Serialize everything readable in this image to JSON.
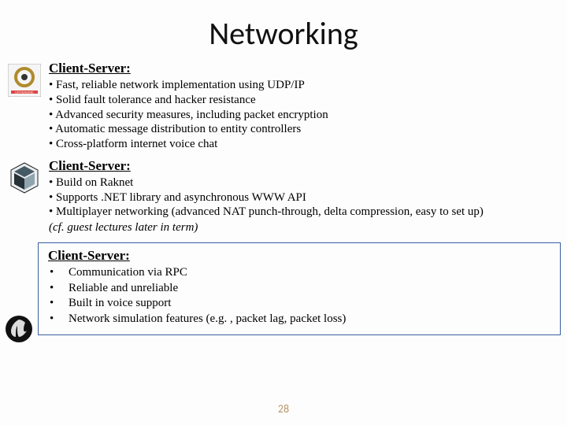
{
  "title": "Networking",
  "sections": [
    {
      "heading": "Client-Server:",
      "bullets": [
        "• Fast, reliable network implementation using UDP/IP",
        "• Solid fault tolerance and hacker resistance",
        "• Advanced security measures, including packet encryption",
        "• Automatic message distribution to entity controllers",
        "• Cross-platform internet voice chat"
      ]
    },
    {
      "heading": "Client-Server:",
      "bullets": [
        "• Build on Raknet",
        "• Supports .NET library and asynchronous WWW API",
        "• Multiplayer networking (advanced NAT punch-through, delta compression, easy to set up)"
      ],
      "note": "(cf. guest lectures later in term)"
    },
    {
      "heading": "Client-Server:",
      "bullets": [
        "Communication via RPC",
        "Reliable and unreliable",
        "Built in voice support",
        "Network simulation features (e.g. , packet lag, packet loss)"
      ]
    }
  ],
  "page_number": "28"
}
